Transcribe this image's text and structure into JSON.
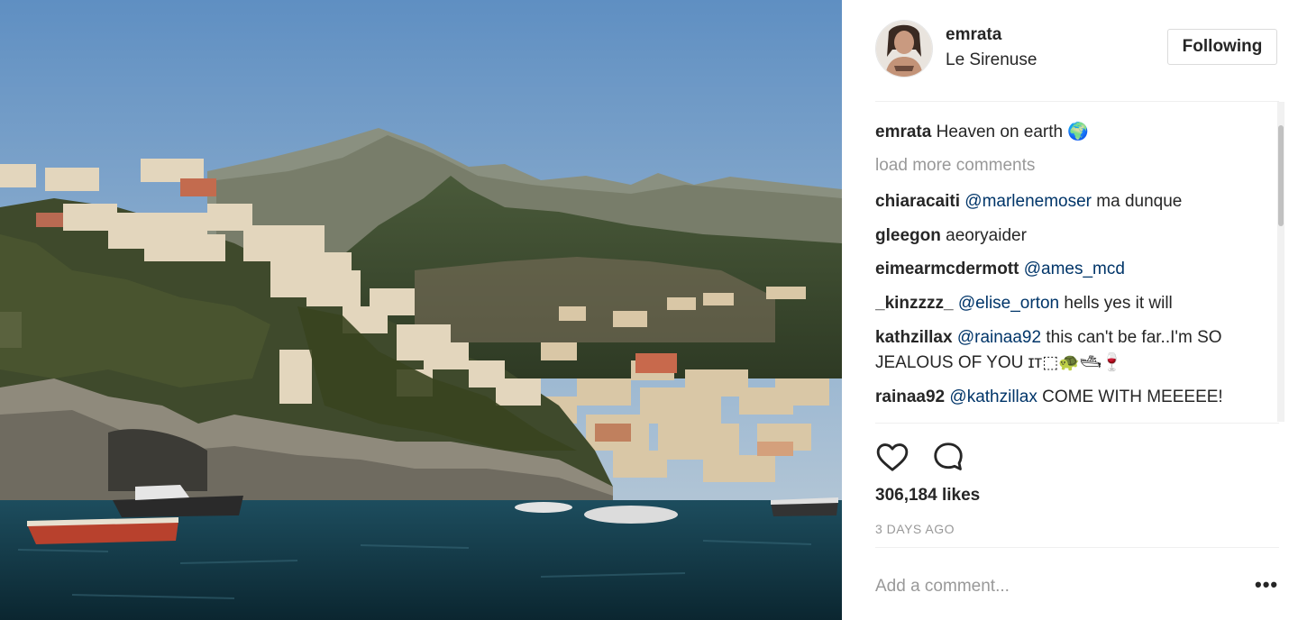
{
  "post": {
    "username": "emrata",
    "location": "Le Sirenuse",
    "follow_label": "Following",
    "caption_user": "emrata",
    "caption_text": "Heaven on earth 🌍",
    "load_more": "load more comments",
    "comments": [
      {
        "user": "chiaracaiti",
        "mention": "@marlenemoser",
        "text": "ma dunque"
      },
      {
        "user": "gleegon",
        "mention": "",
        "text": "aeoryaider"
      },
      {
        "user": "eimearmcdermott",
        "mention": "@ames_mcd",
        "text": ""
      },
      {
        "user": "_kinzzzz_",
        "mention": "@elise_orton",
        "text": "hells yes it will"
      },
      {
        "user": "kathzillax",
        "mention": "@rainaa92",
        "text": "this can't be far..I'm SO JEALOUS OF YOU ɪᴛ⬚🐢🛥🍷"
      },
      {
        "user": "rainaa92",
        "mention": "@kathzillax",
        "text": "COME WITH MEEEEE!"
      }
    ],
    "likes": "306,184 likes",
    "timestamp": "3 DAYS AGO",
    "add_comment_placeholder": "Add a comment...",
    "more_options": "•••"
  },
  "icons": {
    "like": "heart-icon",
    "comment": "comment-bubble-icon"
  }
}
